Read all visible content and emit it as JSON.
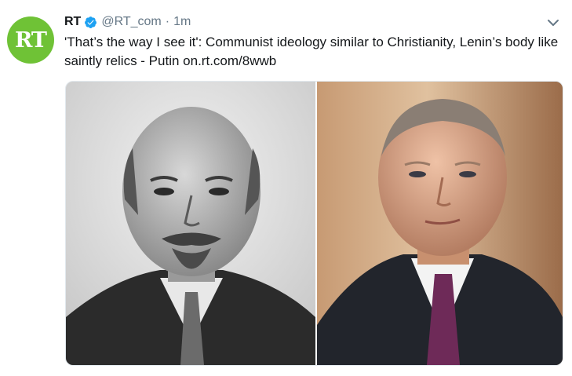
{
  "tweet": {
    "avatar": {
      "label": "RT",
      "color": "#6fc236"
    },
    "author": {
      "name": "RT",
      "handle": "@RT_com",
      "verified": true
    },
    "separator": "·",
    "time": "1m",
    "text": "'That’s the way I see it': Communist ideology similar to Christianity, Lenin’s body like saintly relics - Putin ",
    "link": "on.rt.com/8wwb",
    "icons": [
      "verified-badge-icon",
      "chevron-down-icon"
    ],
    "media": {
      "count": 2,
      "left_photo": "black-and-white portrait of a bald man with goatee and mustache in suit and tie",
      "right_photo": "color portrait of a man in dark suit, white shirt and purple tie"
    },
    "colors": {
      "text": "#14171a",
      "secondary": "#657786",
      "verified": "#1da1f2",
      "accent": "#6fc236"
    }
  }
}
